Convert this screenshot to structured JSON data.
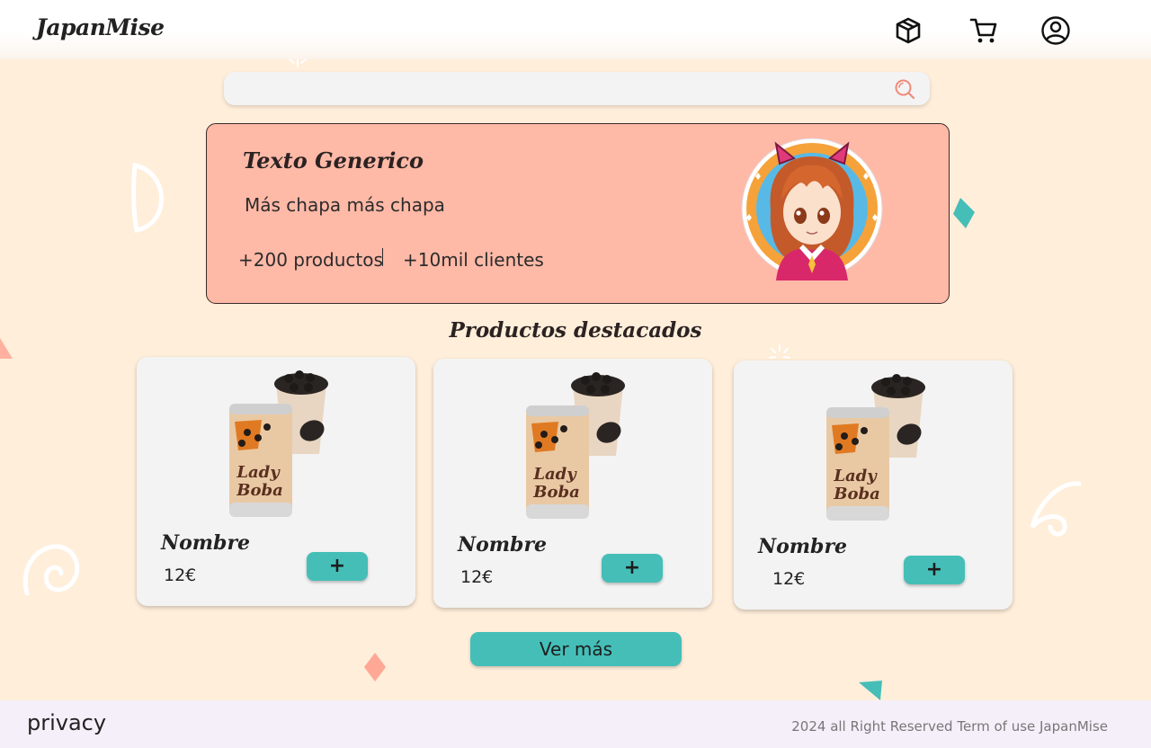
{
  "header": {
    "logo": "JapanMise",
    "icons": [
      "box-icon",
      "cart-icon",
      "user-icon"
    ]
  },
  "search": {
    "placeholder": "",
    "value": ""
  },
  "hero": {
    "title": "Texto Generico",
    "subtitle": "Más chapa más chapa",
    "stat_products": "+200 productos",
    "stat_clients": "+10mil clientes"
  },
  "featured": {
    "title": "Productos destacados",
    "products": [
      {
        "name": "Nombre",
        "price": "12€",
        "add_label": "+"
      },
      {
        "name": "Nombre",
        "price": "12€",
        "add_label": "+"
      },
      {
        "name": "Nombre",
        "price": "12€",
        "add_label": "+"
      }
    ],
    "more_label": "Ver más"
  },
  "footer": {
    "privacy": "privacy",
    "copyright": "2024 all Right Reserved Term of use JapanMise"
  },
  "colors": {
    "background": "#FFEEDA",
    "hero": "#FFB9A7",
    "accent": "#45BEB8",
    "card": "#F3F3F3",
    "footer": "#F5EFFA",
    "search_icon": "#F08A7A"
  }
}
